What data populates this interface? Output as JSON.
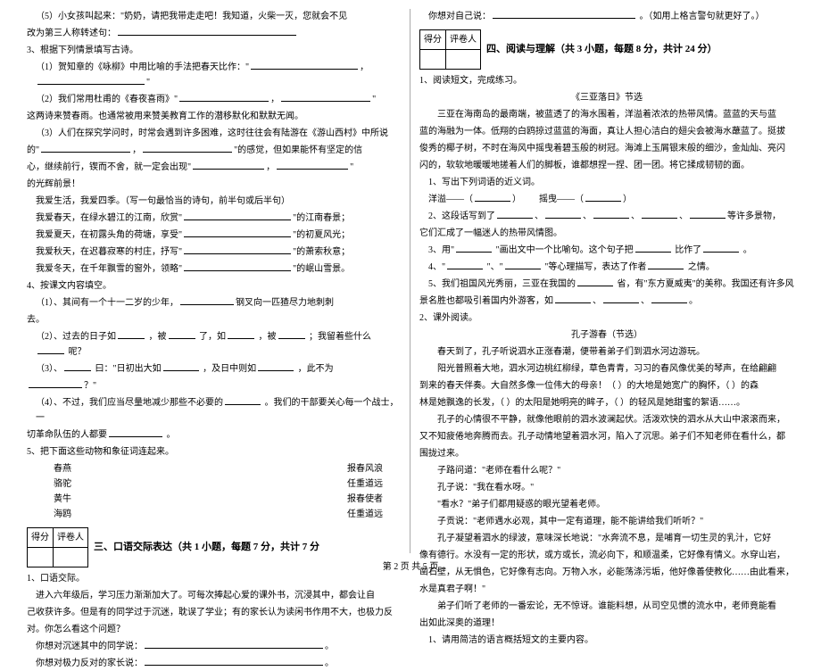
{
  "left": {
    "q5_line1": "（5）小女孩叫起来：\"奶奶，请把我带走走吧！我知道，火柴一灭，您就会不见",
    "q5_line2": "改为第三人称转述句：",
    "q3_head": "3、根据下列情景填写古诗。",
    "q3_1": "（1）贺知章的《咏柳》中用比喻的手法把春天比作：\"",
    "q3_1_end": "\"",
    "q3_2a": "（2）我们常用杜甫的《春夜喜雨》\"",
    "q3_2b": "\"",
    "q3_2c": "这两诗来赞春雨。也通常被用来赞美教育工作的潜移默化和默默无闻。",
    "q3_3a": "（3）人们在探究学问时，时常会遇到许多困难，这时往往会有陆游在《游山西村》中所说",
    "q3_3b": "的\"",
    "q3_3c": "\"的感觉，但如果能怀有坚定的信",
    "q3_3d": "心，继续前行，锲而不舍，就一定会出现\"",
    "q3_3e": "\"",
    "q3_3f": "的光辉前景！",
    "love_intro": "我爱生活，我爱四季。（写一句最恰当的诗句，前半句或后半句）",
    "love_spring_a": "我爱春天，在绿水碧江的江南，欣赏\"",
    "love_spring_b": "\"的江南春景；",
    "love_summer_a": "我爱夏天，在初露头角的荷塘，享受\"",
    "love_summer_b": "\"的初夏风光；",
    "love_autumn_a": "我爱秋天，在迟暮寂寒的村庄，抒写\"",
    "love_autumn_b": "\"的萧索秋意；",
    "love_winter_a": "我爱冬天，在千年飘雪的窗外，领略\"",
    "love_winter_b": "\"的岷山雪景。",
    "q4_head": "4、按课文内容填空。",
    "q4_1a": "（1）、其间有一个十一二岁的少年，",
    "q4_1b": "钢叉向一匹猹尽力地刺刺",
    "q4_1c": "去。",
    "q4_2a": "（2）、过去的日子如",
    "q4_2b": "，被",
    "q4_2c": "了，如",
    "q4_2d": "，被",
    "q4_2e": "；我留着些什么",
    "q4_2f": "呢？",
    "q4_3a": "（3）、",
    "q4_3b": "曰：\"日初出大如",
    "q4_3c": "，及日中则如",
    "q4_3d": "，此不为",
    "q4_3e": "？\"",
    "q4_4a": "（4）、不过，我们应当尽量地减少那些不必要的",
    "q4_4b": "。我们的干部要关心每一个战士，一",
    "q4_4c": "切革命队伍的人都要",
    "q4_4d": "。",
    "q5_head": "5、把下面这些动物和象征词连起来。",
    "match": [
      [
        "春燕",
        "报春风浪"
      ],
      [
        "骆驼",
        "任重道远"
      ],
      [
        "黄牛",
        "报春使者"
      ],
      [
        "海鸥",
        "任重道远"
      ]
    ],
    "sec3_title": "三、口语交际表达（共 1 小题，每题 7 分，共计 7 分",
    "sec3_q1": "1、口语交际。",
    "sec3_body1": "进入六年级后，学习压力渐渐加大了。可每次捧起心爱的课外书，沉浸其中，都会让自",
    "sec3_body2": "己收获许多。但是有的同学过于沉迷，耽误了学业；有的家长认为读闲书作用不大，也极力反",
    "sec3_body3": "对。你怎么看这个问题？",
    "sec3_p1": "你想对沉迷其中的同学说：",
    "sec3_p2": "你想对极力反对的家长说："
  },
  "right": {
    "r_top": "你想对自己说：",
    "r_top_tail": "。（如用上格言警句就更好了。）",
    "sec4_title": "四、阅读与理解（共 3 小题，每题 8 分，共计 24 分）",
    "r_q1": "1、阅读短文，完成练习。",
    "sanya_title": "《三亚落日》节选",
    "sanya_p1": "三亚在海南岛的最南端，被蓝透了的海水围着，洋溢着浓浓的热带风情。蓝蓝的天与蓝",
    "sanya_p2": "蓝的海融为一体。低翔的白鸥掠过蓝蓝的海面，真让人担心洁白的翅尖会被海水蘸蓝了。挺拔",
    "sanya_p3": "俊秀的椰子树，不时在海风中摇曳着碧玉般的树冠。海滩上玉屑银末般的细沙，金灿灿、亮闪",
    "sanya_p4": "闪的，软软地暖暖地搓着人们的脚板，谁都想捏一捏、团一团。将它揉成韧韧的面。",
    "sanya_q1": "1、写出下列词语的近义词。",
    "sanya_word1": "洋溢——（",
    "sanya_word1b": "）",
    "sanya_word2": "摇曳——（",
    "sanya_word2b": "）",
    "sanya_q2": "2、这段话写到了",
    "sanya_q2b": "等许多景物，",
    "sanya_q2c": "它们汇成了一幅迷人的热带风情图。",
    "sanya_q3a": "3、用\"",
    "sanya_q3b": "\"画出文中一个比喻句。这个句子把",
    "sanya_q3c": "比作了",
    "sanya_q3d": "。",
    "sanya_q4a": "4、\"",
    "sanya_q4b": "\"、\"",
    "sanya_q4c": "\"等心理描写，表达了作者",
    "sanya_q4d": "之情。",
    "sanya_q5a": "5、我们祖国风光秀丽，三亚在我国的",
    "sanya_q5b": "省，有\"东方夏威夷\"的美称。我国还有许多风",
    "sanya_q5c": "景名胜也都吸引着国内外游客，如",
    "r_q2": "2、课外阅读。",
    "kongzi_title": "孔子游春（节选）",
    "kz_p1": "春天到了，孔子听说泗水正涨春潮，便带着弟子们到泗水河边游玩。",
    "kz_p2": "阳光普照着大地，泗水河边桃红柳绿，草色青青，习习的春风像优美的琴声，在给翩翩",
    "kz_p3": "到来的春天伴奏。大自然多像一位伟大的母亲！（    ）的大地是她宽广的胸怀，（    ）的森",
    "kz_p4": "林是她飘逸的长发，（    ）的太阳是她明亮的眸子，（    ）的轻风是她甜蜜的絮语……。",
    "kz_p5": "孔子的心情很不平静，就像他眼前的泗水波澜起伏。活泼欢快的泗水从大山中滚滚而来，",
    "kz_p6": "又不知疲倦地奔腾而去。孔子动情地望着泗水河，陷入了沉思。弟子们不知老师在看什么，都",
    "kz_p7": "围拢过来。",
    "kz_l1": "子路问道：\"老师在看什么呢？\"",
    "kz_l2": "孔子说：\"我在看水呀。\"",
    "kz_l3": "\"看水？\"弟子们都用疑惑的眼光望着老师。",
    "kz_l4": "子贡说：\"老师遇水必观，其中一定有道理，能不能讲给我们听听？\"",
    "kz_p8": "孔子凝望着泗水的绿波，意味深长地说：\"水奔流不息，是哺育一切生灵的乳汁，它好",
    "kz_p9": "像有德行。水没有一定的形状，或方或长，流必向下，和顺温柔，它好像有情义。水穿山岩，",
    "kz_p10": "凿石壁，从无惧色，它好像有志向。万物入水，必能荡涤污垢，他好像善使教化……由此看来，",
    "kz_p11": "水是真君子啊！\"",
    "kz_p12": "弟子们听了老师的一番宏论，无不惊讶。谁能料想，从司空见惯的流水中，老师竟能看",
    "kz_p13": "出如此深奥的道理！",
    "kz_q1": "1、请用简洁的语言概括短文的主要内容。"
  },
  "score_labels": {
    "score": "得分",
    "reviewer": "评卷人"
  },
  "footer": "第 2 页  共 5 页"
}
